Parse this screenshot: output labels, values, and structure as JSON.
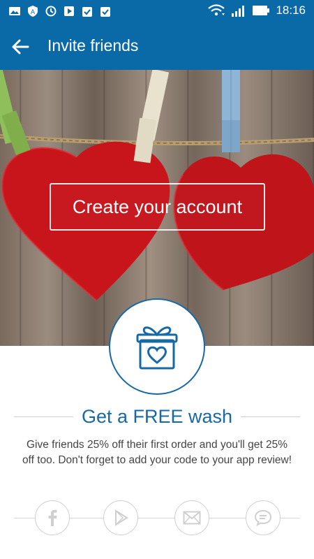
{
  "status_bar": {
    "time": "18:16",
    "left_icons": [
      "image-icon",
      "shield-icon",
      "sync-icon",
      "play-store-icon",
      "clipboard-check-icon",
      "clipboard-check-icon"
    ],
    "right_icons": [
      "wifi-icon",
      "signal-icon",
      "battery-icon"
    ]
  },
  "app_bar": {
    "title": "Invite friends",
    "back_icon": "arrow-back-icon"
  },
  "hero": {
    "cta_label": "Create your account"
  },
  "content": {
    "gift_icon": "gift-heart-icon",
    "headline": "Get a FREE wash",
    "description": "Give friends 25% off their first order and you'll get 25% off too. Don't forget to add your code to your app review!"
  },
  "share": [
    {
      "name": "facebook",
      "icon": "facebook-icon"
    },
    {
      "name": "play-store",
      "icon": "play-store-icon"
    },
    {
      "name": "email",
      "icon": "mail-icon"
    },
    {
      "name": "message",
      "icon": "chat-icon"
    }
  ],
  "colors": {
    "primary": "#0a6aa8",
    "accent_text": "#1769a6",
    "heart": "#c8151c"
  }
}
